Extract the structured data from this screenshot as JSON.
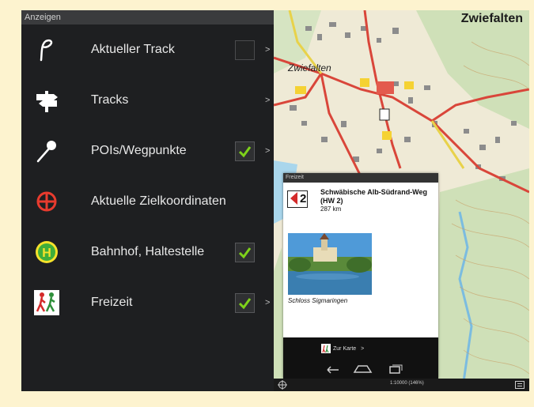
{
  "left_panel": {
    "title": "Anzeigen",
    "items": [
      {
        "label": "Aktueller Track",
        "icon": "track-icon",
        "has_checkbox": true,
        "checked": false,
        "arrow": ">"
      },
      {
        "label": "Tracks",
        "icon": "signpost-icon",
        "has_checkbox": false,
        "arrow": ">"
      },
      {
        "label": "POIs/Wegpunkte",
        "icon": "pin-icon",
        "has_checkbox": true,
        "checked": true,
        "arrow": ">"
      },
      {
        "label": "Aktuelle Zielkoordinaten",
        "icon": "target-icon",
        "has_checkbox": false,
        "arrow": ""
      },
      {
        "label": "Bahnhof, Haltestelle",
        "icon": "bus-stop-icon",
        "has_checkbox": true,
        "checked": true,
        "arrow": ""
      },
      {
        "label": "Freizeit",
        "icon": "hikers-icon",
        "has_checkbox": true,
        "checked": true,
        "arrow": ">"
      }
    ]
  },
  "map": {
    "title": "Zwiefalten",
    "place_label": "Zwiefalten",
    "scale_text": "1:10000 (146%)",
    "colors": {
      "road": "#d9463a",
      "yellow_road": "#e8d24a",
      "forest": "#cfe0b8",
      "water": "#8ec8e8"
    }
  },
  "popup": {
    "header": "Freizeit",
    "route_number": "2",
    "route_title": "Schwäbische Alb-Südrand-Weg (HW 2)",
    "route_length": "287 km",
    "caption": "Schloss Sigmaringen",
    "action": "Zur Karte",
    "action_arrow": ">"
  }
}
